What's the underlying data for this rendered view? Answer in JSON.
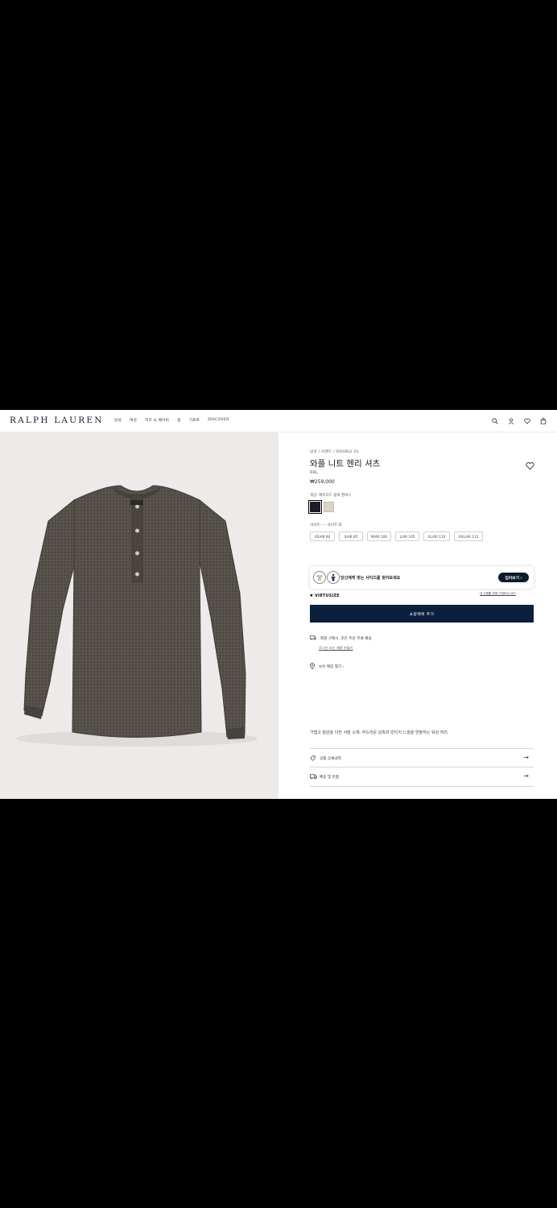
{
  "header": {
    "logo": "RALPH LAUREN",
    "nav": [
      "남성",
      "여성",
      "키즈 & 베이비",
      "홈",
      "기프트",
      "DISCOVER"
    ]
  },
  "product": {
    "breadcrumb": "남성  /  브랜드  /  DOUBLE RL",
    "title": "와플 니트 헨리 셔츠",
    "brand": "RRL",
    "price": "₩259,000",
    "color_label": "색상: 페이디드 블랙 캔버스",
    "colors": [
      "#1a1e24",
      "#d8d2c7"
    ],
    "size_label": "사이즈:  ---  사이즈 표",
    "sizes": [
      "XS/AR 90",
      "S/AR 95",
      "M/AR 100",
      "L/AR 105",
      "XL/AR 110",
      "XXL/AR 115"
    ]
  },
  "fit": {
    "text": "당신에게 맞는 사이즈를 찾아보세요",
    "button": "입어보기 ›",
    "logo": "VIRTUSIZE",
    "note": "내 신체를 위해 구매하시나요?"
  },
  "cart_button": "쇼핑백에 추가",
  "shipping": {
    "text": "회원 구매시, 모든 주문 무료 배송",
    "sub": "로그인 또는 계정 만들기"
  },
  "store": "보유 매장 찾기  ›",
  "description": "가볍고 질감을 더한 서말 소재, 부드러운 감촉과 빈티지 느낌을 연출하는 워싱 처리.",
  "accordion": [
    "상품 상세내역",
    "배송 및 반품"
  ]
}
